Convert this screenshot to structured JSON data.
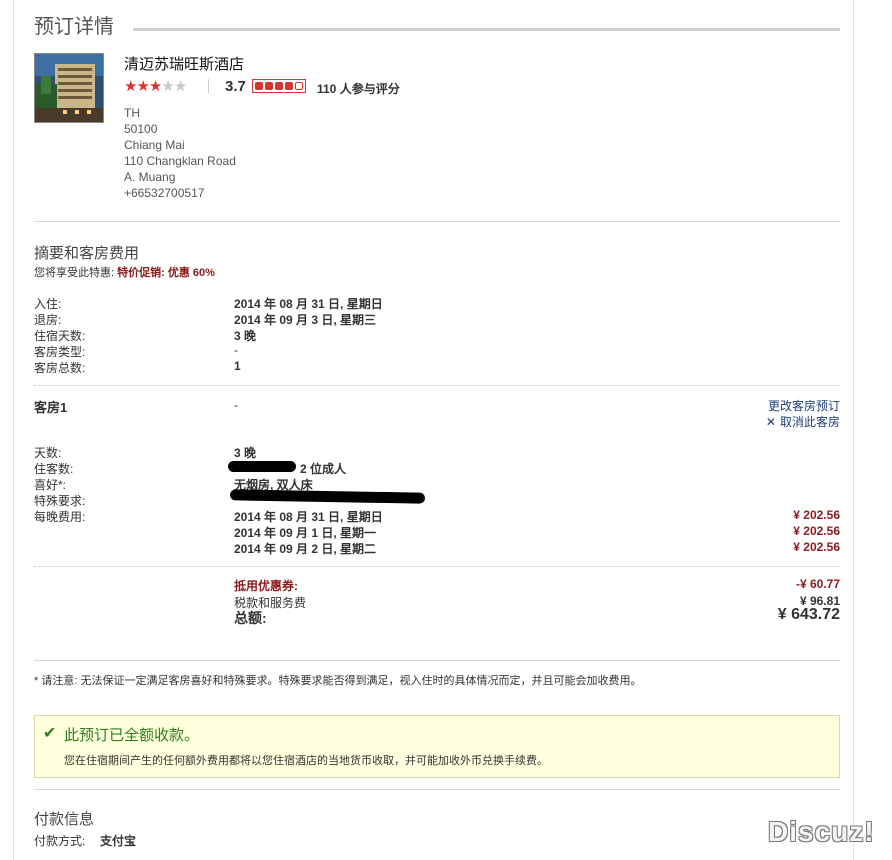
{
  "page_title": "预订详情",
  "hotel": {
    "name": "清迈苏瑞旺斯酒店",
    "stars_on": 3,
    "stars_total": 5,
    "score": "3.7",
    "rating_fraction": 0.74,
    "review_count": "110 人参与评分",
    "address": [
      "TH",
      "50100",
      "Chiang Mai",
      "110 Changklan Road",
      "A. Muang",
      "+66532700517"
    ]
  },
  "summary": {
    "title": "摘要和客房费用",
    "promo_prefix": "您将享受此特惠:",
    "promo_name": "特价促销:",
    "promo_discount_label": "优惠",
    "promo_discount_pct": "60%",
    "rows": [
      {
        "label": "入住:",
        "value": "2014 年 08 月 31 日, 星期日"
      },
      {
        "label": "退房:",
        "value": "2014 年 09 月 3 日, 星期三"
      },
      {
        "label": "住宿天数:",
        "value": "3 晚"
      },
      {
        "label": "客房类型:",
        "value": "-"
      },
      {
        "label": "客房总数:",
        "value": "1"
      }
    ]
  },
  "room": {
    "title": "客房1",
    "type_value": "-",
    "change_link": "更改客房预订",
    "cancel_link": "取消此客房",
    "nights_label": "天数:",
    "nights_value": "3 晚",
    "guests_label": "住客数:",
    "guests_value": "2 位成人",
    "pref_label": "喜好*:",
    "pref_value": "无烟房, 双人床",
    "special_label": "特殊要求:",
    "nightly_label": "每晚费用:",
    "nightly": [
      {
        "date": "2014 年 08 月 31 日, 星期日",
        "price": "¥ 202.56"
      },
      {
        "date": "2014 年 09 月 1 日, 星期一",
        "price": "¥ 202.56"
      },
      {
        "date": "2014 年 09 月 2 日, 星期二",
        "price": "¥ 202.56"
      }
    ]
  },
  "totals": {
    "coupon_label": "抵用优惠券:",
    "coupon_value": "-¥ 60.77",
    "tax_label": "税款和服务费",
    "tax_value": "¥ 96.81",
    "total_label": "总额:",
    "total_value": "¥ 643.72"
  },
  "note": "* 请注意: 无法保证一定满足客房喜好和特殊要求。特殊要求能否得到满足，视入住时的具体情况而定，并且可能会加收费用。",
  "paid_notice": {
    "title": "此预订已全额收款。",
    "body": "您在住宿期间产生的任何额外费用都将以您住宿酒店的当地货币收取，并可能加收外币兑换手续费。"
  },
  "payment": {
    "title": "付款信息",
    "method_label": "付款方式:",
    "method_value": "支付宝"
  },
  "watermark": "Discuz!",
  "colors": {
    "accent_red": "#8b1a1a",
    "star_red": "#d8352f",
    "link_blue": "#1e3f7a",
    "success_green": "#2e7d1f",
    "notice_bg": "#ffffdd"
  }
}
